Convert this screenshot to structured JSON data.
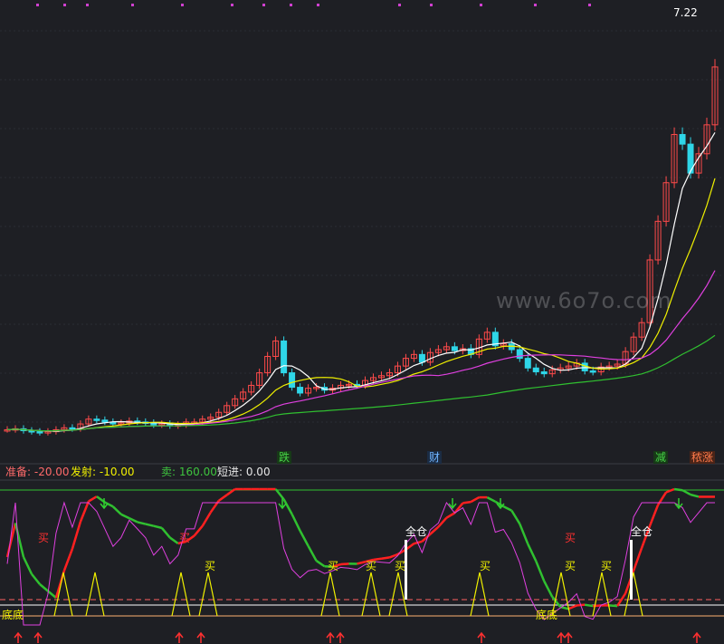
{
  "main_chart": {
    "price_high_label": "7.22",
    "watermark": "www.6o7o.com",
    "markers": [
      {
        "text": "跌",
        "color": "#46d246",
        "bg": "#173a17"
      },
      {
        "text": "财",
        "color": "#6fb4ff",
        "bg": "#1b2c44"
      },
      {
        "text": "减",
        "color": "#46d246",
        "bg": "#173a17"
      },
      {
        "text": "秾涨",
        "color": "#ff7a4a",
        "bg": "#4a2418"
      }
    ]
  },
  "indicator": {
    "header": [
      {
        "label": "准备:",
        "value": "-20.00",
        "color": "#ff6a6a"
      },
      {
        "label": "发射:",
        "value": "-10.00",
        "color": "#f0f000"
      },
      {
        "label": "卖:",
        "value": "160.00",
        "color": "#3ec33e"
      },
      {
        "label": "短进:",
        "value": "0.00",
        "color": "#e6e6e6"
      }
    ],
    "buy_label": "买",
    "full_label": "全仓",
    "bottom_label": "底底"
  },
  "chart_data": {
    "type": "candlestick",
    "x": [
      "1",
      "2",
      "3",
      "4",
      "5",
      "6",
      "7",
      "8",
      "9",
      "10",
      "11",
      "12",
      "13",
      "14",
      "15",
      "16",
      "17",
      "18",
      "19",
      "20",
      "21",
      "22",
      "23",
      "24",
      "25",
      "26",
      "27",
      "28",
      "29",
      "30",
      "31",
      "32",
      "33",
      "34",
      "35",
      "36",
      "37",
      "38",
      "39",
      "40",
      "41",
      "42",
      "43",
      "44",
      "45",
      "46",
      "47",
      "48",
      "49",
      "50",
      "51",
      "52",
      "53",
      "54",
      "55",
      "56",
      "57",
      "58",
      "59",
      "60",
      "61",
      "62",
      "63",
      "64",
      "65",
      "66",
      "67",
      "68",
      "69",
      "70",
      "71",
      "72",
      "73",
      "74",
      "75",
      "76",
      "77",
      "78",
      "79",
      "80",
      "81",
      "82",
      "83",
      "84",
      "85",
      "86",
      "87",
      "88",
      "89",
      "90",
      "91",
      "92",
      "93",
      "94",
      "95",
      "96",
      "97",
      "98",
      "99",
      "100"
    ],
    "close": [
      3.04,
      3.05,
      3.03,
      3.02,
      3.01,
      3.02,
      3.04,
      3.06,
      3.05,
      3.1,
      3.15,
      3.14,
      3.12,
      3.1,
      3.11,
      3.13,
      3.12,
      3.11,
      3.09,
      3.1,
      3.08,
      3.09,
      3.12,
      3.12,
      3.15,
      3.17,
      3.22,
      3.29,
      3.36,
      3.43,
      3.5,
      3.63,
      3.8,
      3.96,
      3.63,
      3.48,
      3.42,
      3.47,
      3.48,
      3.45,
      3.47,
      3.5,
      3.51,
      3.5,
      3.55,
      3.58,
      3.6,
      3.63,
      3.7,
      3.78,
      3.82,
      3.74,
      3.84,
      3.87,
      3.9,
      3.86,
      3.88,
      3.82,
      3.98,
      4.05,
      3.91,
      3.93,
      3.87,
      3.78,
      3.68,
      3.64,
      3.62,
      3.66,
      3.68,
      3.7,
      3.73,
      3.65,
      3.64,
      3.69,
      3.7,
      3.72,
      3.85,
      4.0,
      4.15,
      4.8,
      5.2,
      5.6,
      6.1,
      6.0,
      5.7,
      5.9,
      6.2,
      6.8
    ]
  }
}
